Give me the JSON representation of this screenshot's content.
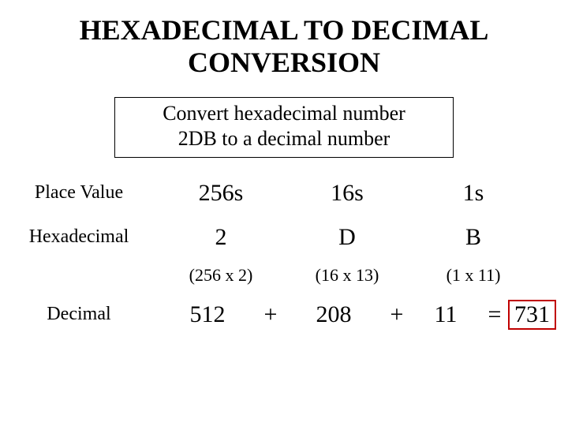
{
  "title_line1": "HEXADECIMAL  TO  DECIMAL",
  "title_line2": "CONVERSION",
  "subtitle_line1": "Convert hexadecimal number",
  "subtitle_line2": "2DB to a decimal number",
  "labels": {
    "place_value": "Place Value",
    "hexadecimal": "Hexadecimal",
    "decimal": "Decimal"
  },
  "place_values": [
    "256s",
    "16s",
    "1s"
  ],
  "hex_digits": [
    "2",
    "D",
    "B"
  ],
  "calcs": [
    "(256 x 2)",
    "(16 x 13)",
    "(1 x 11)"
  ],
  "dec_parts": [
    "512",
    "208",
    "11"
  ],
  "ops": {
    "plus": "+",
    "eq": "="
  },
  "result": "731"
}
